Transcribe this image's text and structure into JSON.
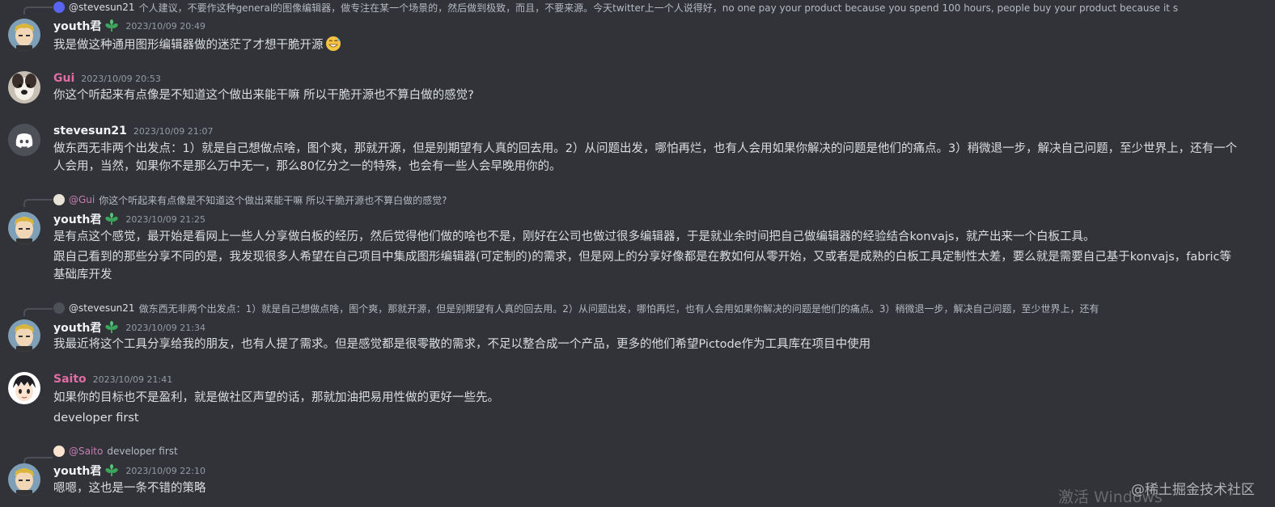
{
  "colors": {
    "background": "#313338",
    "text": "#dbdee1",
    "timestamp": "#949ba4",
    "username_pink": "#e06ca3",
    "badge_green": "#3ba55c"
  },
  "messages": [
    {
      "reply": {
        "name": "@stevesun21",
        "text": "个人建议，不要作这种general的图像编辑器，做专注在某一个场景的，然后做到极致，而且，不要来源。今天twitter上一个人说得好，no one pay your product because you spend 100 hours, people buy your product because it s"
      },
      "user": "youth君",
      "time": "2023/10/09 20:49",
      "lines": [
        "我是做这种通用图形编辑器做的迷茫了才想干脆开源"
      ],
      "emoji": "sweat-smile-emoji"
    },
    {
      "user": "Gui",
      "time": "2023/10/09 20:53",
      "lines": [
        "你这个听起来有点像是不知道这个做出来能干嘛 所以干脆开源也不算白做的感觉?"
      ]
    },
    {
      "user": "stevesun21",
      "time": "2023/10/09 21:07",
      "lines": [
        "做东西无非两个出发点：1）就是自己想做点啥，图个爽，那就开源，但是别期望有人真的回去用。2）从问题出发，哪怕再烂，也有人会用如果你解决的问题是他们的痛点。3）稍微退一步，解决自己问题，至少世界上，还有一个人会用，当然，如果你不是那么万中无一，那么80亿分之一的特殊，也会有一些人会早晚用你的。"
      ]
    },
    {
      "reply": {
        "name": "@Gui",
        "text": "你这个听起来有点像是不知道这个做出来能干嘛 所以干脆开源也不算白做的感觉?"
      },
      "user": "youth君",
      "time": "2023/10/09 21:25",
      "lines": [
        "是有点这个感觉，最开始是看网上一些人分享做白板的经历，然后觉得他们做的啥也不是，刚好在公司也做过很多编辑器，于是就业余时间把自己做编辑器的经验结合konvajs，就产出来一个白板工具。",
        "跟自己看到的那些分享不同的是，我发现很多人希望在自己项目中集成图形编辑器(可定制的)的需求，但是网上的分享好像都是在教如何从零开始，又或者是成熟的白板工具定制性太差，要么就是需要自己基于konvajs，fabric等基础库开发"
      ]
    },
    {
      "reply": {
        "name": "@stevesun21",
        "text": "做东西无非两个出发点：1）就是自己想做点啥，图个爽，那就开源，但是别期望有人真的回去用。2）从问题出发，哪怕再烂，也有人会用如果你解决的问题是他们的痛点。3）稍微退一步，解决自己问题，至少世界上，还有"
      },
      "user": "youth君",
      "time": "2023/10/09 21:34",
      "lines": [
        "我最近将这个工具分享给我的朋友，也有人提了需求。但是感觉都是很零散的需求，不足以整合成一个产品，更多的他们希望Pictode作为工具库在项目中使用"
      ]
    },
    {
      "user": "Saito",
      "time": "2023/10/09 21:41",
      "lines": [
        "如果你的目标也不是盈利，就是做社区声望的话，那就加油把易用性做的更好一些先。",
        "developer first"
      ]
    },
    {
      "reply": {
        "name": "@Saito",
        "text": "developer first"
      },
      "user": "youth君",
      "time": "2023/10/09 22:10",
      "lines": [
        "嗯嗯，这也是一条不错的策略"
      ]
    }
  ],
  "watermarks": {
    "os": "激活 Windows",
    "site": "@稀土掘金技术社区"
  }
}
